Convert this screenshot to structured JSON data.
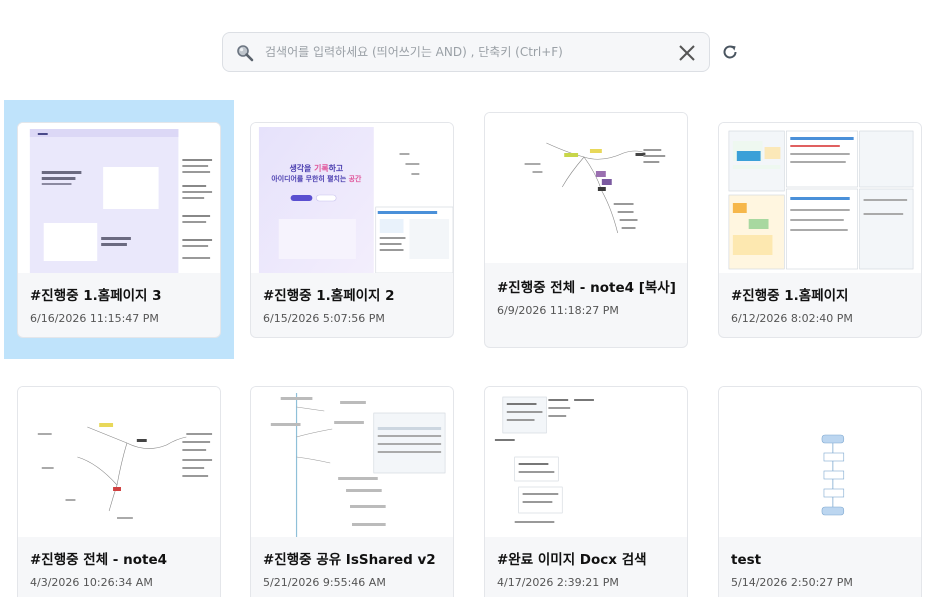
{
  "search": {
    "placeholder": "검색어를 입력하세요 (띄어쓰기는 AND) , 단축키 (Ctrl+F)",
    "value": ""
  },
  "icons": {
    "search": "magnifier-icon",
    "clear": "close-icon",
    "refresh": "refresh-icon"
  },
  "colors": {
    "selection": "#bfe3fb",
    "card_bg": "#f6f7f9"
  },
  "selected_card": 0,
  "cards": [
    {
      "title": "#진행중 1.홈페이지 3",
      "date": "6/16/2026 11:15:47 PM"
    },
    {
      "title": "#진행중 1.홈페이지 2",
      "date": "6/15/2026 5:07:56 PM",
      "thumb_text": {
        "line1_a": "생각을 ",
        "line1_b": "기록",
        "line1_c": "하고",
        "line2_a": "아이디어를 무한히 펼치는 ",
        "line2_b": "공간"
      }
    },
    {
      "title": "#진행중 전체 - note4 [복사]",
      "date": "6/9/2026 11:18:27 PM"
    },
    {
      "title": "#진행중 1.홈페이지",
      "date": "6/12/2026 8:02:40 PM"
    },
    {
      "title": "#진행중 전체 - note4",
      "date": "4/3/2026 10:26:34 AM"
    },
    {
      "title": "#진행중 공유 IsShared v2",
      "date": "5/21/2026 9:55:46 AM"
    },
    {
      "title": "#완료 이미지 Docx 검색",
      "date": "4/17/2026 2:39:21 PM"
    },
    {
      "title": "test",
      "date": "5/14/2026 2:50:27 PM"
    }
  ]
}
